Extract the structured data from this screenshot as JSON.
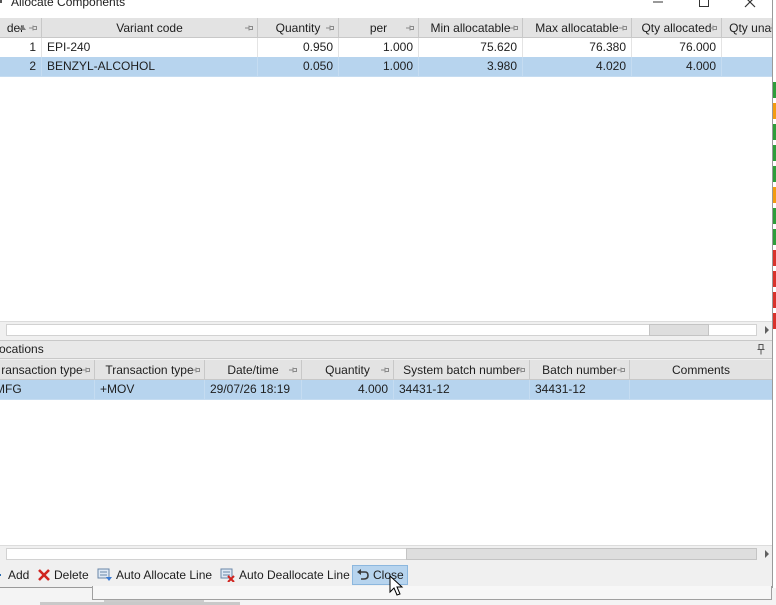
{
  "window": {
    "title": "Allocate Components"
  },
  "components_grid": {
    "columns": [
      {
        "label": "der"
      },
      {
        "label": "Variant code"
      },
      {
        "label": "Quantity"
      },
      {
        "label": "per"
      },
      {
        "label": "Min allocatable"
      },
      {
        "label": "Max allocatable"
      },
      {
        "label": "Qty allocated"
      },
      {
        "label": "Qty unal"
      }
    ],
    "rows": [
      {
        "order": "1",
        "variant_code": "EPI-240",
        "quantity": "0.950",
        "per": "1.000",
        "min_allocatable": "75.620",
        "max_allocatable": "76.380",
        "qty_allocated": "76.000",
        "qty_unallocated": "",
        "selected": false
      },
      {
        "order": "2",
        "variant_code": "BENZYL-ALCOHOL",
        "quantity": "0.050",
        "per": "1.000",
        "min_allocatable": "3.980",
        "max_allocatable": "4.020",
        "qty_allocated": "4.000",
        "qty_unallocated": "",
        "selected": true
      }
    ],
    "scroll_position": 0.93
  },
  "allocations_panel": {
    "caption": "ocations",
    "columns": [
      {
        "label": "ransaction type"
      },
      {
        "label": "Transaction type"
      },
      {
        "label": "Date/time"
      },
      {
        "label": "Quantity"
      },
      {
        "label": "System batch number"
      },
      {
        "label": "Batch number"
      },
      {
        "label": "Comments"
      }
    ],
    "rows": [
      {
        "transaction_type_1": "MFG",
        "transaction_type_2": "+MOV",
        "date_time": "29/07/26 18:19",
        "quantity": "4.000",
        "system_batch_number": "34431-12",
        "batch_number": "34431-12",
        "comments": "",
        "selected": true
      }
    ],
    "scroll_position": 0.0
  },
  "toolbar": {
    "add_label": "Add",
    "delete_label": "Delete",
    "auto_allocate_label": "Auto Allocate Line",
    "auto_deallocate_label": "Auto Deallocate Line",
    "close_label": "Close"
  },
  "colors": {
    "selection": "#b7d4ee",
    "header": "#e3e3e3",
    "status_orange": "#f39c12",
    "status_green": "#2e9e3a",
    "status_red": "#d9322b"
  },
  "status_strip": [
    "green",
    "orange",
    "green",
    "green",
    "green",
    "orange",
    "green",
    "green",
    "red",
    "red",
    "red",
    "red"
  ]
}
